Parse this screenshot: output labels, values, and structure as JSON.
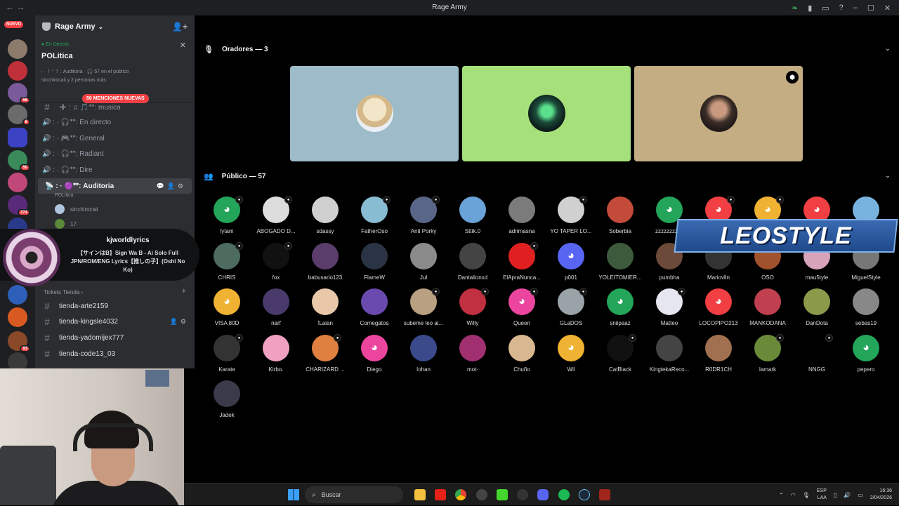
{
  "window": {
    "title": "Rage Army"
  },
  "guilds": {
    "nuevo_top": "NUEVO",
    "nuevo_bottom": "NUEVO",
    "badges": [
      "56",
      "8",
      "50",
      "374",
      "93"
    ]
  },
  "server": {
    "name": "Rage Army"
  },
  "live": {
    "status": "En Directo",
    "title": "POLitica",
    "meta": "፡ · ꒰ ᑋ ꒱ : Auditoria · 🎧 57 en el público",
    "people": "sinchirocaii y 2 personas más"
  },
  "mentions_pill": "50 MENCIONES NUEVAS",
  "channels": [
    {
      "icon": "#",
      "label": "᯽ : ♫ 🎵ᕯ: musica"
    },
    {
      "icon": "🔊",
      "label": "🔊 : · 🎧ᕯ: En directo"
    },
    {
      "icon": "🔊",
      "label": "🔊 : · 🎮ᕯ: General"
    },
    {
      "icon": "🔊",
      "label": "🔊 : · 🎧ᕯ: Radiant"
    },
    {
      "icon": "🔊",
      "label": "🔊 : · 🎧ᕯ: Dire"
    },
    {
      "icon": "📡",
      "label": "📡 : · 🟣ᕯ: Auditoria",
      "sub": "POLitica"
    }
  ],
  "voice_users": [
    {
      "name": "sinchirocaii"
    },
    {
      "name": "17"
    }
  ],
  "music": {
    "channel": "kjworldlyrics",
    "track": "【サインはB】Sign Wa B - Ai Solo Full JPN/ROM/ENG Lyrics【推しの子】(Oshi No Ko)"
  },
  "category": {
    "label": "Tickets Tienda ›"
  },
  "ticket_channels": [
    {
      "label": "tienda-arte2159"
    },
    {
      "label": "tienda-kingsle4032"
    },
    {
      "label": "tienda-yadomijex777"
    },
    {
      "label": "tienda-code13_03"
    }
  ],
  "speakers": {
    "header": "Oradores — 3",
    "tiles": [
      {
        "bg": "#9dbbc9",
        "avatar": "#e8dcc0"
      },
      {
        "bg": "#a6e07a",
        "avatar": "#2a6b4a"
      },
      {
        "bg": "#c4ad83",
        "avatar": "#3b2e28"
      }
    ]
  },
  "audience": {
    "header": "Público — 57",
    "members": [
      {
        "name": "lytam",
        "color": "#23a55a",
        "discord": true,
        "mic": true
      },
      {
        "name": "ABOGADO D...",
        "color": "#ddd",
        "mic": true
      },
      {
        "name": "sdassy",
        "color": "#cfcfcf"
      },
      {
        "name": "FatherOso",
        "color": "#88bcd2",
        "mic": true
      },
      {
        "name": "Anti Porky",
        "color": "#5a6688",
        "mic": true
      },
      {
        "name": "Sttik.0",
        "color": "#6aa3d8"
      },
      {
        "name": "adrimasna",
        "color": "#7b7b7b"
      },
      {
        "name": "YO TAPER LO...",
        "color": "#d0d0d0",
        "mic": true
      },
      {
        "name": "Soberbia",
        "color": "#c24b3a"
      },
      {
        "name": "zzzzzzzzzz",
        "color": "#23a55a",
        "discord": true
      },
      {
        "name": "",
        "color": "#f23f43",
        "discord": true,
        "mic": true
      },
      {
        "name": "",
        "color": "#f0b232",
        "discord": true,
        "mic": true
      },
      {
        "name": "",
        "color": "#f23f43",
        "discord": true
      },
      {
        "name": "",
        "color": "#78b3e0"
      },
      {
        "name": "CHRIS",
        "color": "#4e6b60",
        "mic": true
      },
      {
        "name": "fox",
        "color": "#111",
        "mic": true
      },
      {
        "name": "babusario123",
        "color": "#5a3d6b"
      },
      {
        "name": "FlameW",
        "color": "#2b3444"
      },
      {
        "name": "Jul",
        "color": "#8a8a8a"
      },
      {
        "name": "Dantalionxd",
        "color": "#444"
      },
      {
        "name": "ElApraNunca...",
        "color": "#e02020",
        "mic": true
      },
      {
        "name": "p001",
        "color": "#5865f2",
        "discord": true
      },
      {
        "name": "YOLEITOMIER...",
        "color": "#3d5a3d"
      },
      {
        "name": "pumbha",
        "color": "#6b4a3a"
      },
      {
        "name": "Mariovlln",
        "color": "#333"
      },
      {
        "name": "OSO",
        "color": "#a0522d"
      },
      {
        "name": "mau5tyle",
        "color": "#d7a3b8"
      },
      {
        "name": "MiguelStyle",
        "color": "#777"
      },
      {
        "name": "VISA 80D",
        "color": "#f0b232",
        "discord": true
      },
      {
        "name": "narf",
        "color": "#4a3a6b"
      },
      {
        "name": "!Laian",
        "color": "#e8c8a8"
      },
      {
        "name": "Comegatos",
        "color": "#6b4ab0"
      },
      {
        "name": "subeme leo al...",
        "color": "#b8a080",
        "mic": true
      },
      {
        "name": "Willy",
        "color": "#c03040",
        "mic": true
      },
      {
        "name": "Queen",
        "color": "#eb459e",
        "discord": true,
        "mic": true
      },
      {
        "name": "GLaDOS",
        "color": "#9aa3a8",
        "mic": true
      },
      {
        "name": "sniipaaz",
        "color": "#23a55a",
        "discord": true
      },
      {
        "name": "Matteo",
        "color": "#e6e6f0",
        "mic": true
      },
      {
        "name": "LOCOPIPO213",
        "color": "#f23f43",
        "discord": true
      },
      {
        "name": "MANKODANA",
        "color": "#c04050"
      },
      {
        "name": "DanDota",
        "color": "#8a9a4a"
      },
      {
        "name": "sebas19",
        "color": "#888"
      },
      {
        "name": "Karate",
        "color": "#333",
        "mic": true
      },
      {
        "name": "Kirbo.",
        "color": "#f0a0c0"
      },
      {
        "name": "CHARIZARD ...",
        "color": "#e08040",
        "mic": true
      },
      {
        "name": "Diego",
        "color": "#eb459e",
        "discord": true
      },
      {
        "name": "Iohan",
        "color": "#3a4a8a"
      },
      {
        "name": "mot-",
        "color": "#a03070"
      },
      {
        "name": "Chuño",
        "color": "#d8b890"
      },
      {
        "name": "Wil",
        "color": "#f0b232",
        "discord": true
      },
      {
        "name": "CatBlack",
        "color": "#111",
        "mic": true
      },
      {
        "name": "KingtekaReco...",
        "color": "#444"
      },
      {
        "name": "R0DR1CH",
        "color": "#a07050"
      },
      {
        "name": "lamark",
        "color": "#6a8a3a",
        "mic": true
      },
      {
        "name": "NNGG",
        "color": "#000",
        "mic": true
      },
      {
        "name": "pepero",
        "color": "#23a55a",
        "discord": true
      },
      {
        "name": "Jadek",
        "color": "#3a3a4a"
      }
    ]
  },
  "overlay": {
    "text": "LEOSTYLE"
  },
  "taskbar": {
    "search_placeholder": "Buscar",
    "lang_top": "ESP",
    "lang_bottom": "LAA",
    "time": "16:36",
    "date": "2/04/2026"
  }
}
